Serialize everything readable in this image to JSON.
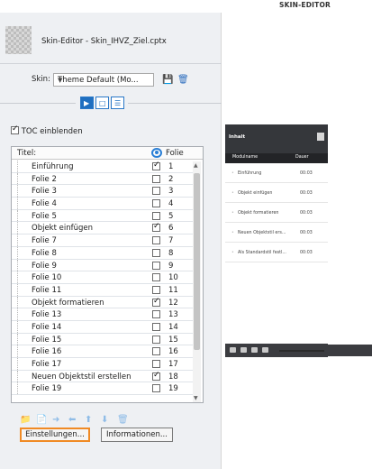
{
  "app": {
    "title": "SKIN-EDITOR"
  },
  "header": {
    "file_label": "Skin-Editor - Skin_IHVZ_Ziel.cptx"
  },
  "skin": {
    "label": "Skin:",
    "value": "Theme Default (Mo...",
    "save_icon": "save-icon",
    "delete_icon": "delete-icon"
  },
  "tabs": [
    {
      "name": "playback-tab",
      "icon": "play-icon",
      "active": true
    },
    {
      "name": "borders-tab",
      "icon": "square-icon",
      "active": false
    },
    {
      "name": "toc-tab",
      "icon": "list-icon",
      "active": false
    }
  ],
  "toc_checkbox": {
    "label": "TOC einblenden",
    "checked": true
  },
  "list": {
    "col_title": "Titel:",
    "col_slide": "Folie",
    "rows": [
      {
        "title": "Einführung",
        "checked": true,
        "num": "1"
      },
      {
        "title": "Folie 2",
        "checked": false,
        "num": "2"
      },
      {
        "title": "Folie 3",
        "checked": false,
        "num": "3"
      },
      {
        "title": "Folie 4",
        "checked": false,
        "num": "4"
      },
      {
        "title": "Folie 5",
        "checked": false,
        "num": "5"
      },
      {
        "title": "Objekt einfügen",
        "checked": true,
        "num": "6"
      },
      {
        "title": "Folie 7",
        "checked": false,
        "num": "7"
      },
      {
        "title": "Folie 8",
        "checked": false,
        "num": "8"
      },
      {
        "title": "Folie 9",
        "checked": false,
        "num": "9"
      },
      {
        "title": "Folie 10",
        "checked": false,
        "num": "10"
      },
      {
        "title": "Folie 11",
        "checked": false,
        "num": "11"
      },
      {
        "title": "Objekt formatieren",
        "checked": true,
        "num": "12"
      },
      {
        "title": "Folie 13",
        "checked": false,
        "num": "13"
      },
      {
        "title": "Folie 14",
        "checked": false,
        "num": "14"
      },
      {
        "title": "Folie 15",
        "checked": false,
        "num": "15"
      },
      {
        "title": "Folie 16",
        "checked": false,
        "num": "16"
      },
      {
        "title": "Folie 17",
        "checked": false,
        "num": "17"
      },
      {
        "title": "Neuen Objektstil erstellen",
        "checked": true,
        "num": "18"
      },
      {
        "title": "Folie 19",
        "checked": false,
        "num": "19"
      }
    ]
  },
  "toolbar_icons": [
    "folder-icon",
    "new-entry-icon",
    "move-right-icon",
    "move-left-icon",
    "move-up-icon",
    "move-down-icon",
    "delete-icon"
  ],
  "buttons": {
    "settings": "Einstellungen...",
    "info": "Informationen..."
  },
  "preview": {
    "title": "Inhalt",
    "col_name": "Modulname",
    "col_duration": "Dauer",
    "rows": [
      {
        "title": "Einführung",
        "duration": "00:03"
      },
      {
        "title": "Objekt einfügen",
        "duration": "00:03"
      },
      {
        "title": "Objekt formatieren",
        "duration": "00:03"
      },
      {
        "title": "Neuen Objektstil ers...",
        "duration": "00:03"
      },
      {
        "title": "Als Standardstil festl...",
        "duration": "00:03"
      }
    ]
  },
  "colors": {
    "accent": "#1f6fc0",
    "highlight": "#f08a24",
    "preview_dark": "#35373b"
  }
}
